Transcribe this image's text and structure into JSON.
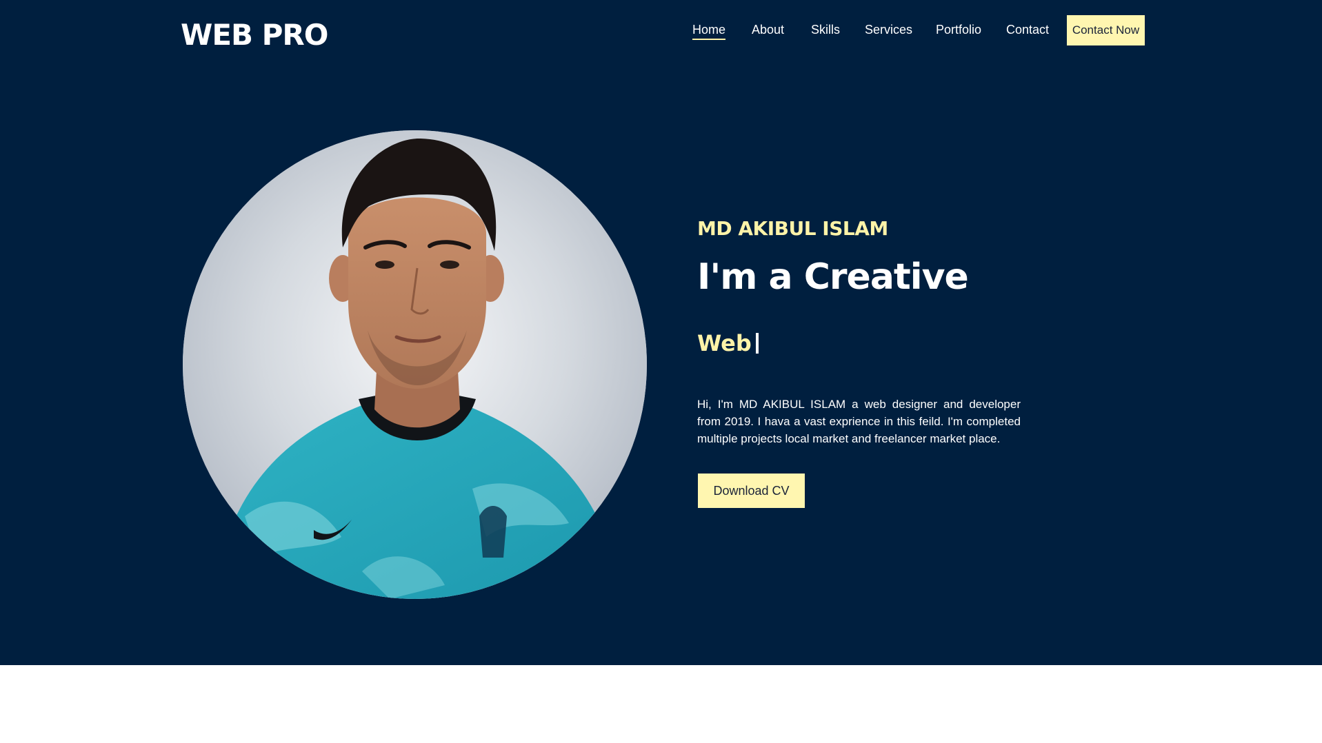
{
  "header": {
    "brand": "WEB PRO",
    "nav": [
      {
        "label": "Home",
        "active": true
      },
      {
        "label": "About",
        "active": false
      },
      {
        "label": "Skills",
        "active": false
      },
      {
        "label": "Services",
        "active": false
      },
      {
        "label": "Portfolio",
        "active": false
      },
      {
        "label": "Contact",
        "active": false
      }
    ],
    "cta_label": "Contact Now"
  },
  "hero": {
    "kicker": "MD AKIBUL ISLAM",
    "headline": "I'm a Creative",
    "typed_text": "Web",
    "bio": "Hi, I'm MD AKIBUL ISLAM a web designer and developer from 2019. I hava a vast exprience in this feild. I'm completed multiple projects local market and freelancer market place.",
    "cv_button": "Download CV",
    "portrait_alt": "profile-photo"
  },
  "colors": {
    "background": "#001f3f",
    "accent": "#fff3a8",
    "button_bg": "#fff6b0",
    "text": "#ffffff"
  }
}
